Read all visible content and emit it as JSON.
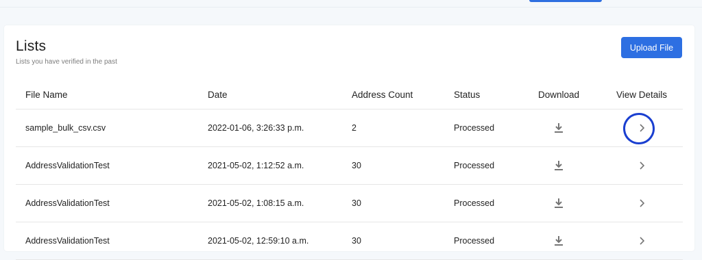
{
  "page": {
    "title": "Lists",
    "subtitle": "Lists you have verified in the past",
    "upload_button": "Upload File"
  },
  "colors": {
    "accent": "#2d6fe2",
    "annotation": "#1a3fd0",
    "background": "#f5f8fb"
  },
  "table": {
    "headers": {
      "file_name": "File Name",
      "date": "Date",
      "address_count": "Address Count",
      "status": "Status",
      "download": "Download",
      "view_details": "View Details"
    },
    "rows": [
      {
        "file_name": "sample_bulk_csv.csv",
        "date": "2022-01-06, 3:26:33 p.m.",
        "address_count": "2",
        "status": "Processed",
        "download_icon": "download-icon",
        "view_icon": "chevron-right-icon"
      },
      {
        "file_name": "AddressValidationTest",
        "date": "2021-05-02, 1:12:52 a.m.",
        "address_count": "30",
        "status": "Processed",
        "download_icon": "download-icon",
        "view_icon": "chevron-right-icon"
      },
      {
        "file_name": "AddressValidationTest",
        "date": "2021-05-02, 1:08:15 a.m.",
        "address_count": "30",
        "status": "Processed",
        "download_icon": "download-icon",
        "view_icon": "chevron-right-icon"
      },
      {
        "file_name": "AddressValidationTest",
        "date": "2021-05-02, 12:59:10 a.m.",
        "address_count": "30",
        "status": "Processed",
        "download_icon": "download-icon",
        "view_icon": "chevron-right-icon"
      }
    ]
  }
}
